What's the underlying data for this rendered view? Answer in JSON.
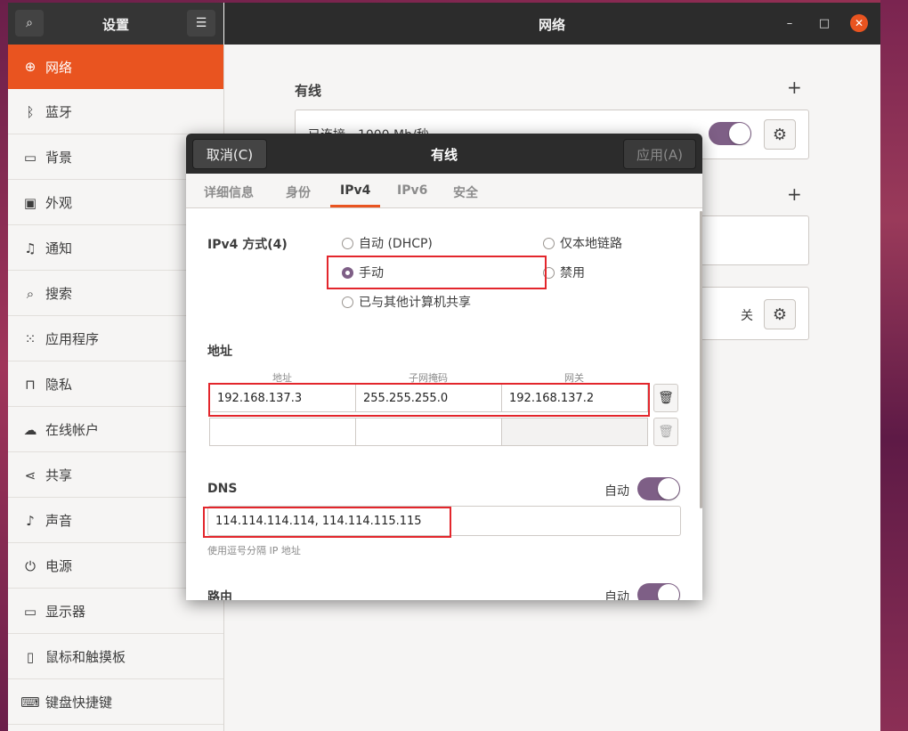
{
  "window": {
    "left_title": "设置",
    "right_title": "网络",
    "min_symbol": "–",
    "max_symbol": "□",
    "close_symbol": "✕",
    "menu_symbol": "☰",
    "search_symbol": "⌕"
  },
  "sidebar": {
    "items": [
      {
        "label": "网络",
        "icon": "⊕"
      },
      {
        "label": "蓝牙",
        "icon": "ᛒ"
      },
      {
        "label": "背景",
        "icon": "▭"
      },
      {
        "label": "外观",
        "icon": "▣"
      },
      {
        "label": "通知",
        "icon": "♫"
      },
      {
        "label": "搜索",
        "icon": "⌕"
      },
      {
        "label": "应用程序",
        "icon": "⁙"
      },
      {
        "label": "隐私",
        "icon": "⊓"
      },
      {
        "label": "在线帐户",
        "icon": "☁"
      },
      {
        "label": "共享",
        "icon": "⋖"
      },
      {
        "label": "声音",
        "icon": "♪"
      },
      {
        "label": "电源",
        "icon": "⏻"
      },
      {
        "label": "显示器",
        "icon": "▭"
      },
      {
        "label": "鼠标和触摸板",
        "icon": "▯"
      },
      {
        "label": "键盘快捷键",
        "icon": "⌨"
      }
    ]
  },
  "main": {
    "wired_title": "有线",
    "wired_status": "已连接 - 1000 Mb/秒",
    "proxy_state": "关",
    "plus_symbol": "+",
    "gear_symbol": "⚙"
  },
  "dialog": {
    "cancel_label": "取消(C)",
    "title": "有线",
    "apply_label": "应用(A)",
    "tabs": [
      "详细信息",
      "身份",
      "IPv4",
      "IPv6",
      "安全"
    ],
    "ipv4_method_label": "IPv4 方式(4)",
    "methods": {
      "auto": "自动 (DHCP)",
      "link_local": "仅本地链路",
      "manual": "手动",
      "disabled": "禁用",
      "shared": "已与其他计算机共享"
    },
    "address_section": "地址",
    "col_headers": [
      "地址",
      "子网掩码",
      "网关"
    ],
    "address_row": {
      "address": "192.168.137.3",
      "netmask": "255.255.255.0",
      "gateway": "192.168.137.2"
    },
    "trash_symbol": "🗑",
    "dns_label": "DNS",
    "dns_auto_label": "自动",
    "dns_value": "114.114.114.114, 114.114.115.115",
    "dns_hint": "使用逗号分隔 IP 地址",
    "route_label": "路由",
    "route_auto_label": "自动"
  },
  "colors": {
    "accent": "#e95420",
    "toggle": "#7e5f86",
    "annotation": "#e3262c"
  }
}
